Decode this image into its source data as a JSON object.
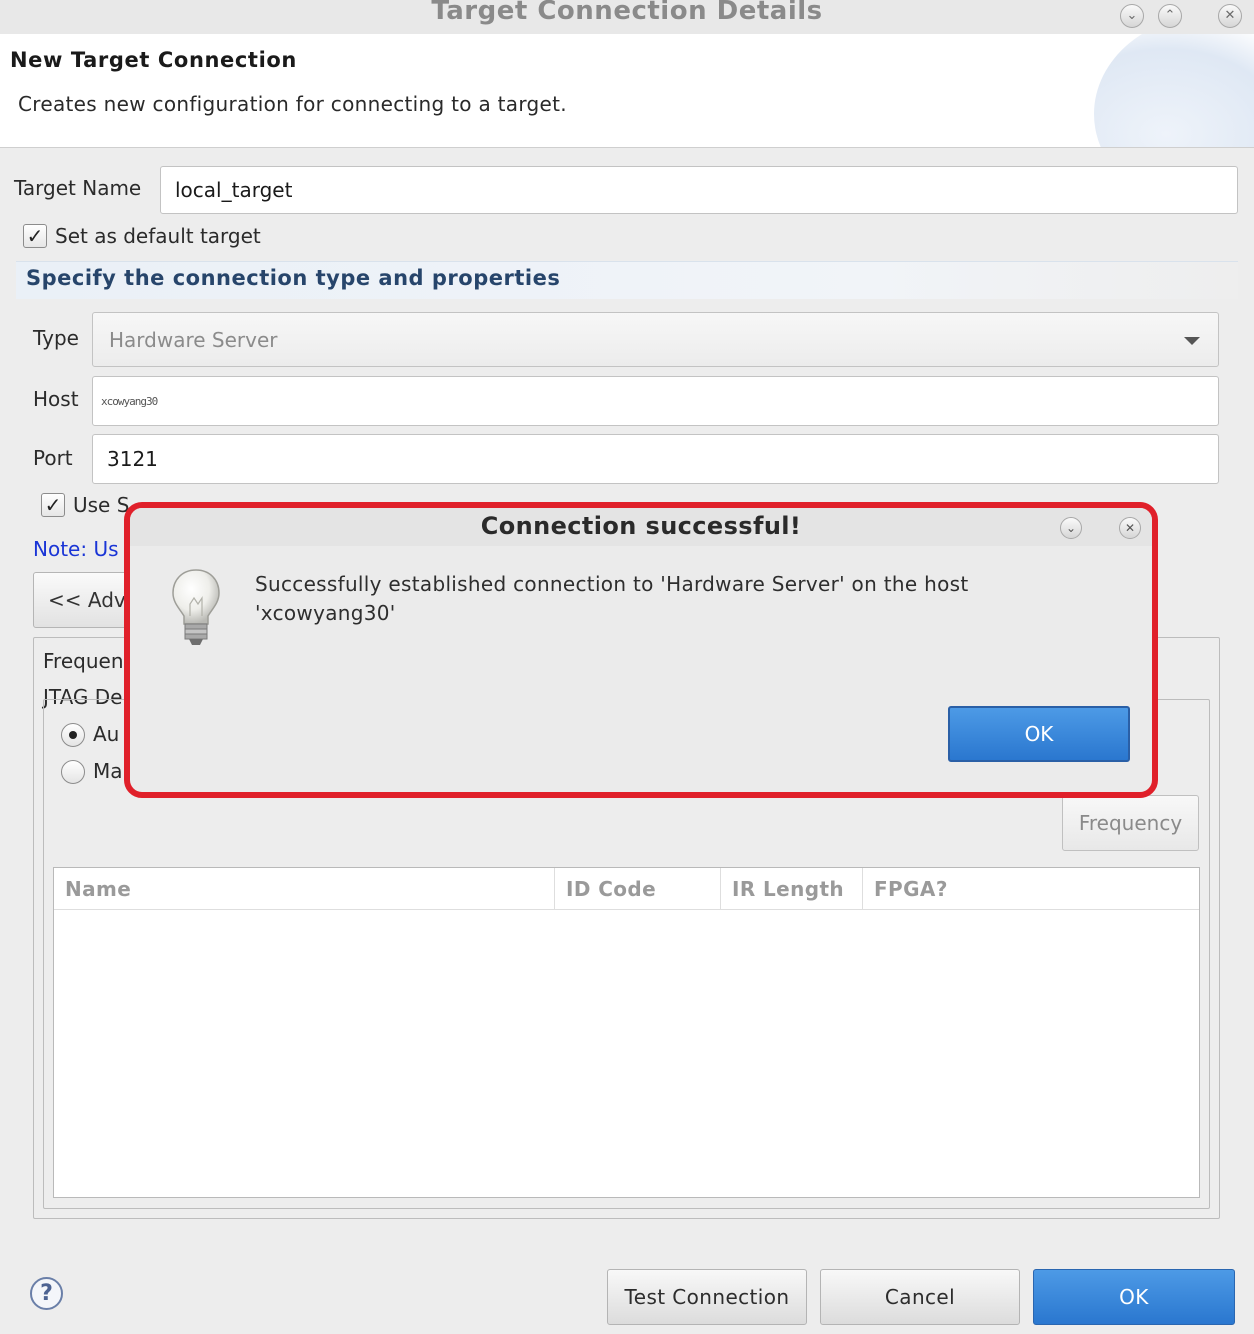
{
  "window": {
    "title": "Target Connection Details",
    "controls": {
      "minimize": "⌄",
      "maximize": "⌃",
      "close": "✕"
    }
  },
  "header": {
    "title": "New Target Connection",
    "description": "Creates new configuration for connecting to a target."
  },
  "form": {
    "target_name_label": "Target Name",
    "target_name_value": "local_target",
    "default_target_label": "Set as default target",
    "default_target_checked": true,
    "section_title": "Specify the connection type and properties",
    "type_label": "Type",
    "type_value": "Hardware Server",
    "host_label": "Host",
    "host_value": "xcowyang30",
    "port_label": "Port",
    "port_value": "3121",
    "use_symbol_label_partial": "Use S",
    "use_symbol_checked": true,
    "note_partial": "Note: Us",
    "advanced_button_partial": "<< Adv",
    "frequency_label_partial": "Frequen",
    "jtag_label_partial": "JTAG De",
    "radio_auto_partial": "Au",
    "radio_manual_partial": "Ma",
    "radio_auto_selected": true,
    "frequency_button": "Frequency"
  },
  "table": {
    "columns": [
      "Name",
      "ID Code",
      "IR Length",
      "FPGA?"
    ],
    "rows": []
  },
  "footer": {
    "help_icon": "?",
    "test_connection": "Test Connection",
    "cancel": "Cancel",
    "ok": "OK"
  },
  "popup": {
    "title": "Connection successful!",
    "message_line1": "Successfully established connection to 'Hardware Server' on the host",
    "message_line2": "'xcowyang30'",
    "ok": "OK",
    "icon": "lightbulb-icon",
    "highlight_color": "#e0202a"
  },
  "colors": {
    "accent_blue": "#2a77cf",
    "section_title": "#27456b",
    "note_link": "#1a35d6"
  }
}
